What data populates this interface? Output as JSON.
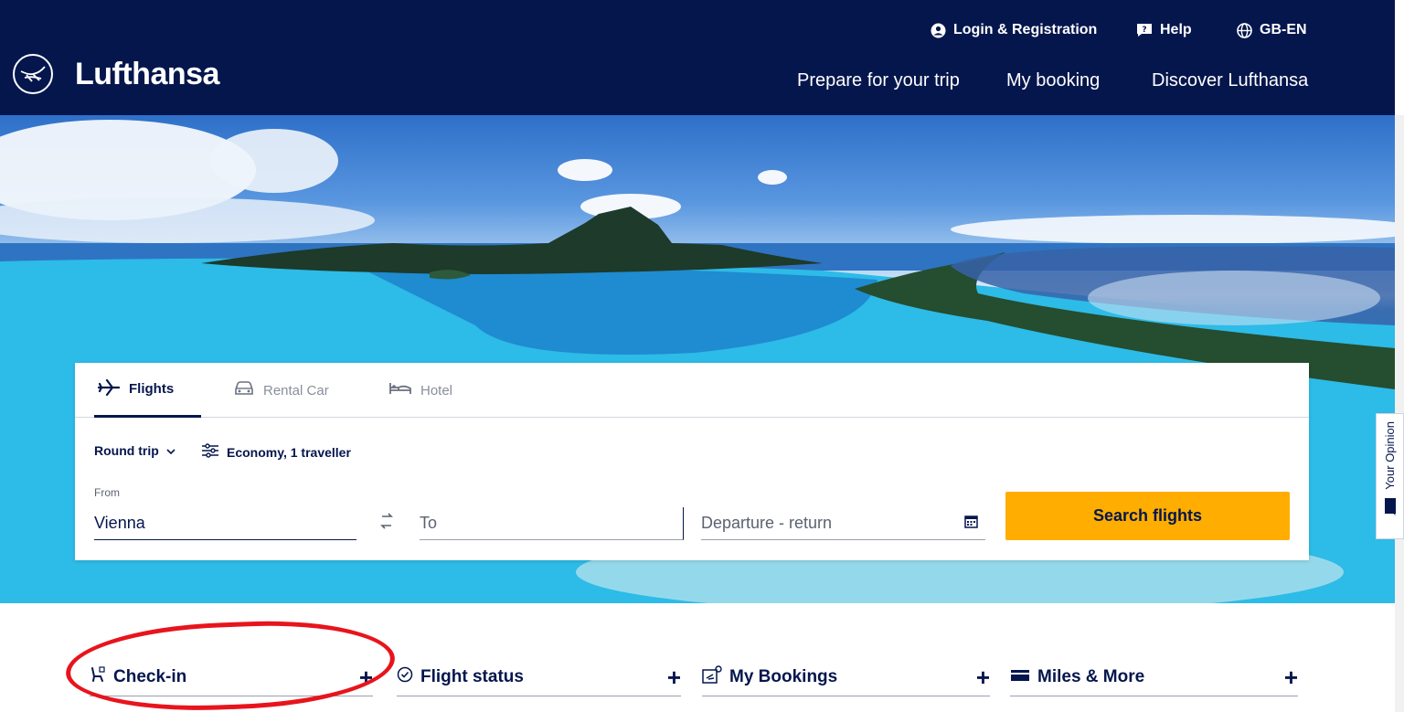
{
  "header": {
    "brand": "Lufthansa",
    "login": "Login & Registration",
    "help": "Help",
    "locale": "GB-EN",
    "nav": [
      "Prepare for your trip",
      "My booking",
      "Discover Lufthansa"
    ]
  },
  "booking": {
    "tabs": [
      {
        "label": "Flights",
        "active": true
      },
      {
        "label": "Rental Car",
        "active": false
      },
      {
        "label": "Hotel",
        "active": false
      }
    ],
    "trip_type": "Round trip",
    "cabin": "Economy, 1 traveller",
    "from_label": "From",
    "from_value": "Vienna",
    "to_placeholder": "To",
    "dates_placeholder": "Departure - return",
    "search_label": "Search flights"
  },
  "opinion": "Your Opinion",
  "quicklinks": [
    {
      "label": "Check-in",
      "icon": "seat-icon"
    },
    {
      "label": "Flight status",
      "icon": "clock-icon"
    },
    {
      "label": "My Bookings",
      "icon": "booking-icon"
    },
    {
      "label": "Miles & More",
      "icon": "card-icon"
    }
  ],
  "colors": {
    "navy": "#05164d",
    "accent": "#ffad00",
    "annotation": "#e8141c"
  }
}
